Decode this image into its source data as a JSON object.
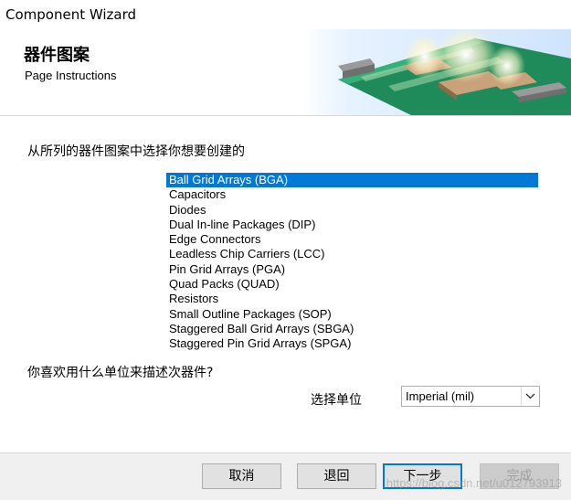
{
  "window": {
    "title": "Component Wizard"
  },
  "header": {
    "heading": "器件图案",
    "subheading": "Page Instructions"
  },
  "content": {
    "prompt": "从所列的器件图案中选择你想要创建的",
    "patterns": [
      "Ball Grid Arrays (BGA)",
      "Capacitors",
      "Diodes",
      "Dual In-line Packages (DIP)",
      "Edge Connectors",
      "Leadless Chip Carriers (LCC)",
      "Pin Grid Arrays (PGA)",
      "Quad Packs (QUAD)",
      "Resistors",
      "Small Outline Packages (SOP)",
      "Staggered Ball Grid Arrays (SBGA)",
      "Staggered Pin Grid Arrays (SPGA)"
    ],
    "selected_pattern": "Ball Grid Arrays (BGA)",
    "units_question": "你喜欢用什么单位来描述次器件?",
    "units_label": "选择单位",
    "units_value": "Imperial (mil)",
    "dropdown_icon": "chevron-down-icon"
  },
  "footer": {
    "cancel_label": "取消",
    "back_label": "退回",
    "next_label": "下一步",
    "finish_label": "完成",
    "watermark": "https://blog.csdn.net/u012793913"
  },
  "colors": {
    "selection": "#0078d7",
    "footer_bg": "#f0f0f0",
    "banner_board": "#1f8a5a"
  }
}
